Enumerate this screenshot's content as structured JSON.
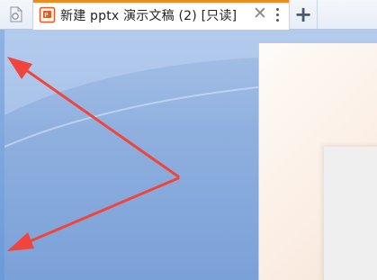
{
  "tabs": {
    "home_icon": "document-home-icon",
    "active": {
      "title": "新建 pptx 演示文稿 (2) [只读]",
      "icon": "powerpoint-file-icon",
      "accent": "#f08a1c"
    },
    "new_tab_label": "+"
  }
}
